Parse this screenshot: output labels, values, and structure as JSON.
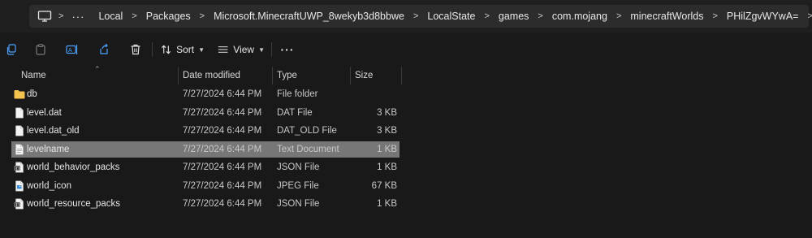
{
  "address_bar": {
    "breadcrumbs": [
      "Local",
      "Packages",
      "Microsoft.MinecraftUWP_8wekyb3d8bbwe",
      "LocalState",
      "games",
      "com.mojang",
      "minecraftWorlds",
      "PHilZgvWYwA="
    ],
    "separator": ">",
    "more": "···"
  },
  "toolbar": {
    "sort_label": "Sort",
    "view_label": "View",
    "more_label": "···"
  },
  "columns": {
    "name": "Name",
    "date": "Date modified",
    "type": "Type",
    "size": "Size"
  },
  "files": [
    {
      "name": "db",
      "date": "7/27/2024 6:44 PM",
      "type": "File folder",
      "size": "",
      "icon": "folder-icon",
      "selected": false
    },
    {
      "name": "level.dat",
      "date": "7/27/2024 6:44 PM",
      "type": "DAT File",
      "size": "3 KB",
      "icon": "file-icon",
      "selected": false
    },
    {
      "name": "level.dat_old",
      "date": "7/27/2024 6:44 PM",
      "type": "DAT_OLD File",
      "size": "3 KB",
      "icon": "file-icon",
      "selected": false
    },
    {
      "name": "levelname",
      "date": "7/27/2024 6:44 PM",
      "type": "Text Document",
      "size": "1 KB",
      "icon": "text-file-icon",
      "selected": true
    },
    {
      "name": "world_behavior_packs",
      "date": "7/27/2024 6:44 PM",
      "type": "JSON File",
      "size": "1 KB",
      "icon": "json-file-icon",
      "selected": false
    },
    {
      "name": "world_icon",
      "date": "7/27/2024 6:44 PM",
      "type": "JPEG File",
      "size": "67 KB",
      "icon": "image-file-icon",
      "selected": false
    },
    {
      "name": "world_resource_packs",
      "date": "7/27/2024 6:44 PM",
      "type": "JSON File",
      "size": "1 KB",
      "icon": "json-file-icon",
      "selected": false
    }
  ],
  "colors": {
    "background": "#191919",
    "address_bar": "#2c2c2c",
    "selection": "#777777",
    "folder": "#f2c14e"
  }
}
